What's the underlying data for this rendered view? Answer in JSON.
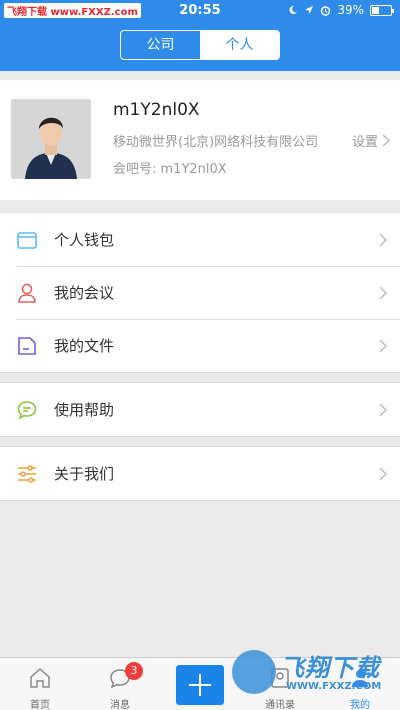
{
  "status_bar": {
    "watermark": "飞翔下载 www.FXXZ.com",
    "time": "20:55",
    "battery": "39%",
    "battery_level": 0.39
  },
  "header": {
    "segments": [
      "公司",
      "个人"
    ],
    "selected": "个人"
  },
  "profile": {
    "name": "m1Y2nl0X",
    "company": "移动微世界(北京)网络科技有限公司",
    "id_line": "会吧号: m1Y2nl0X",
    "setting_label": "设置"
  },
  "menu": [
    {
      "label": "个人钱包",
      "icon": "wallet-icon",
      "color": "#5bb8f0"
    },
    {
      "label": "我的会议",
      "icon": "person-meeting-icon",
      "color": "#e8605a"
    },
    {
      "label": "我的文件",
      "icon": "folder-icon",
      "color": "#7a5bd8"
    },
    {
      "label": "使用帮助",
      "icon": "chat-help-icon",
      "color": "#8cc63f"
    },
    {
      "label": "关于我们",
      "icon": "sliders-icon",
      "color": "#f0a43c"
    }
  ],
  "tabbar": {
    "tabs": [
      {
        "label": "首页",
        "icon": "home-icon"
      },
      {
        "label": "消息",
        "icon": "message-icon",
        "badge": "3"
      },
      {
        "label": "通讯录",
        "icon": "contacts-icon"
      },
      {
        "label": "我的",
        "icon": "profile-icon",
        "active": true
      }
    ],
    "center_button": "plus-icon"
  },
  "watermark_overlay": {
    "text": "飞翔下载",
    "url": "WWW.FXXZ.COM"
  },
  "colors": {
    "brand": "#2f8be9",
    "badge": "#f03c3c"
  }
}
